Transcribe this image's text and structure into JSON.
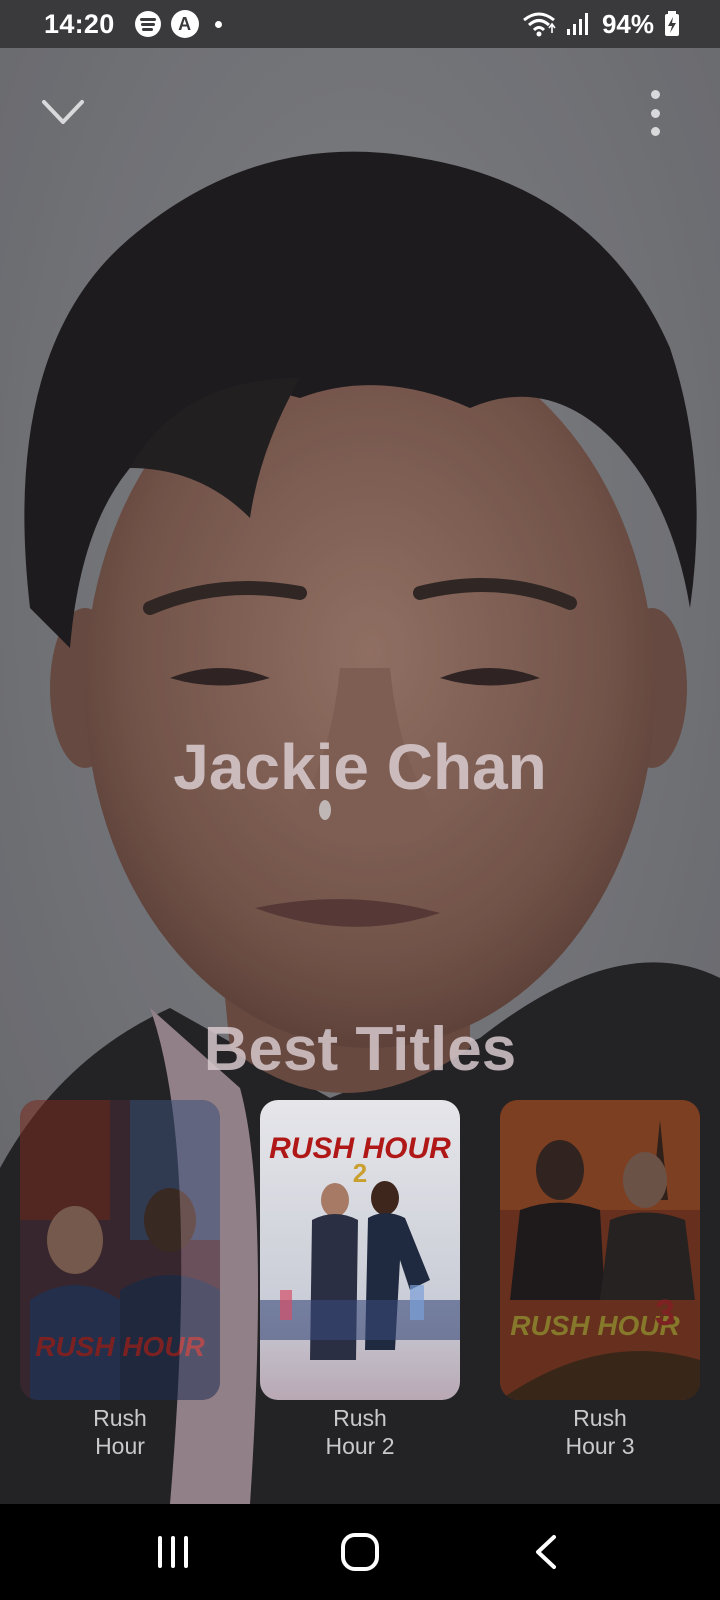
{
  "status_bar": {
    "time": "14:20",
    "left_icons": [
      "spotify-icon",
      "app-a-icon",
      "notification-dot"
    ],
    "app_a_letter": "A",
    "right_icons": [
      "wifi-icon",
      "signal-icon",
      "battery-charging-icon"
    ],
    "battery": "94%"
  },
  "top_bar": {
    "collapse_icon": "chevron-down-icon",
    "more_icon": "more-vertical-icon"
  },
  "actor": {
    "name": "Jackie Chan"
  },
  "best_titles": {
    "heading": "Best Titles",
    "items": [
      {
        "label": "Rush Hour",
        "poster_text": "RUSH HOUR",
        "selected": false
      },
      {
        "label": "Rush Hour 2",
        "poster_text": "RUSH HOUR",
        "poster_number": "2",
        "selected": true
      },
      {
        "label": "Rush Hour 3",
        "poster_text": "RUSH HOUR",
        "poster_number": "3",
        "selected": false
      }
    ]
  },
  "nav_bar": {
    "icons": [
      "recent-apps-icon",
      "home-icon",
      "back-icon"
    ]
  },
  "colors": {
    "status_bar_bg": "#3a3a3c",
    "hero_bg": "#7e7f83",
    "heading_text": "#d6c8cc",
    "label_text": "#c9c9cc",
    "nav_bg": "#000000"
  }
}
